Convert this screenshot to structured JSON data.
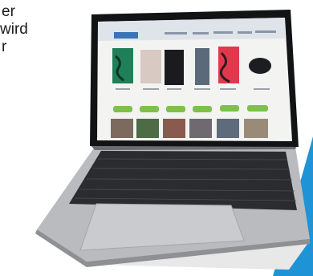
{
  "text_fragments": [
    "er",
    "wird",
    "r"
  ],
  "colors": {
    "laptop_body": "#b9bbbe",
    "keyboard": "#2a2c30",
    "screen_bezel": "#121315",
    "shop_background": "#f3f4f1",
    "shop_header": "#dfe4ea",
    "shop_logo": "#3a74b8",
    "shop_buttons": "#7cc14a",
    "accent_shape": "#1e93d6"
  },
  "products": [
    {
      "name": "green-patterned-shirt",
      "color": "#1f7f57"
    },
    {
      "name": "light-garment",
      "color": "#d8c9c3"
    },
    {
      "name": "black-vest",
      "color": "#1b1b1f"
    },
    {
      "name": "grey-jeans",
      "color": "#5a6a7a"
    },
    {
      "name": "red-patterned-shirt",
      "color": "#e0394d"
    },
    {
      "name": "black-cap",
      "color": "#1c1d20"
    }
  ],
  "interior_tiles": [
    {
      "name": "interior-tile-1",
      "color": "#7d6a5e"
    },
    {
      "name": "interior-tile-2",
      "color": "#4d6b44"
    },
    {
      "name": "interior-tile-3",
      "color": "#8a5a4e"
    },
    {
      "name": "interior-tile-4",
      "color": "#6f6a70"
    },
    {
      "name": "interior-tile-5",
      "color": "#5e6b7c"
    },
    {
      "name": "interior-tile-6",
      "color": "#9a8b78"
    }
  ]
}
